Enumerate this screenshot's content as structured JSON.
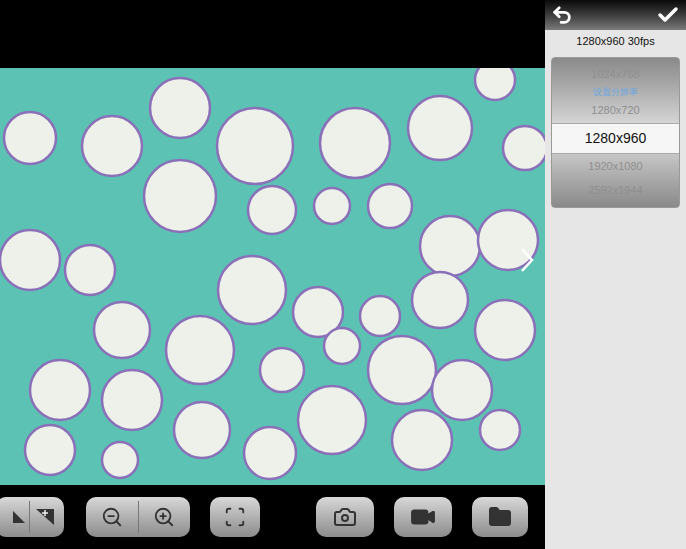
{
  "settings_panel": {
    "status": "1280x960 30fps"
  },
  "resolution_picker": {
    "title": "设置分辨率",
    "options": [
      {
        "label": "1024x768",
        "selected": false
      },
      {
        "label": "1280x720",
        "selected": false
      },
      {
        "label": "1280x960",
        "selected": true
      },
      {
        "label": "1920x1080",
        "selected": false
      },
      {
        "label": "2592x1944",
        "selected": false
      }
    ]
  }
}
